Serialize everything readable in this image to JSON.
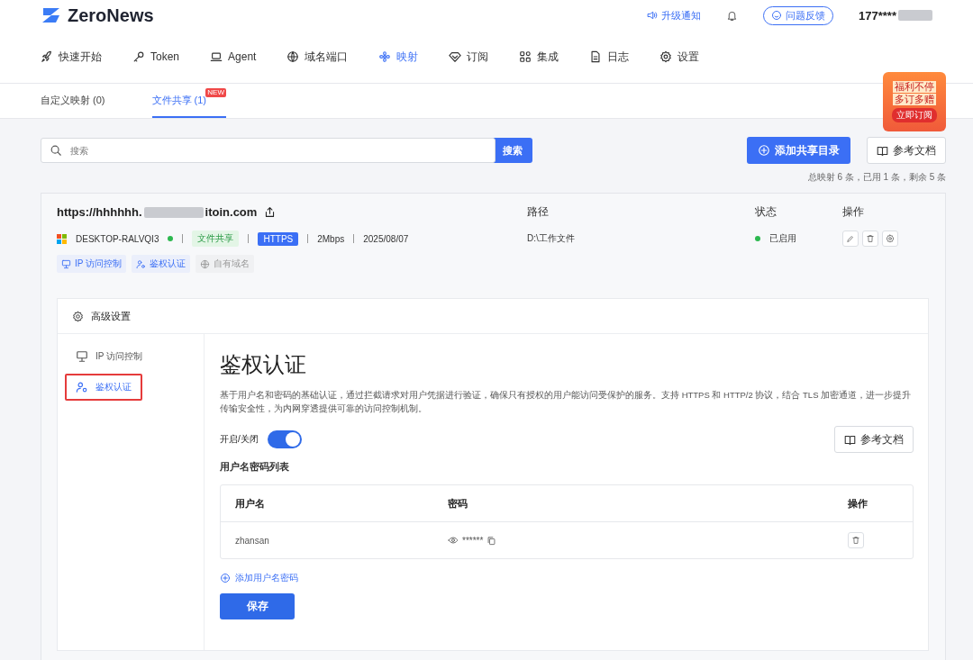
{
  "header": {
    "logo": "ZeroNews",
    "upgrade": "升级通知",
    "feedback": "问题反馈",
    "user": "177****"
  },
  "nav": [
    {
      "label": "快速开始",
      "selected": false
    },
    {
      "label": "Token",
      "selected": false
    },
    {
      "label": "Agent",
      "selected": false
    },
    {
      "label": "域名端口",
      "selected": false
    },
    {
      "label": "映射",
      "selected": true
    },
    {
      "label": "订阅",
      "selected": false
    },
    {
      "label": "集成",
      "selected": false
    },
    {
      "label": "日志",
      "selected": false
    },
    {
      "label": "设置",
      "selected": false
    }
  ],
  "subtabs": [
    {
      "label": "自定义映射 (0)",
      "selected": false
    },
    {
      "label": "文件共享 (1)",
      "selected": true,
      "badge": "NEW"
    }
  ],
  "promo": {
    "line1": "福利不停",
    "line2": "多订多赠",
    "button": "立即订阅"
  },
  "search": {
    "placeholder": "搜索",
    "button": "搜索"
  },
  "add_button": "添加共享目录",
  "docs_button": "参考文档",
  "summary": "总映射 6 条，已用 1 条，剩余 5 条",
  "mapping": {
    "url_prefix": "https://hhhhhh.",
    "url_suffix": "itoin.com",
    "col_path": "路径",
    "col_status": "状态",
    "col_actions": "操作",
    "device": "DESKTOP-RALVQI3",
    "online": true,
    "type_tag": "文件共享",
    "protocol": "HTTPS",
    "bandwidth": "2Mbps",
    "date": "2025/08/07",
    "path": "D:\\工作文件",
    "status": "已启用",
    "features": [
      {
        "label": "IP 访问控制",
        "enabled": true
      },
      {
        "label": "鉴权认证",
        "enabled": true
      },
      {
        "label": "自有域名",
        "enabled": false
      }
    ]
  },
  "advanced": {
    "title": "高级设置",
    "side_items": [
      {
        "label": "IP 访问控制",
        "selected": false,
        "highlighted": false
      },
      {
        "label": "鉴权认证",
        "selected": true,
        "highlighted": true
      }
    ],
    "heading": "鉴权认证",
    "description": "基于用户名和密码的基础认证，通过拦截请求对用户凭据进行验证，确保只有授权的用户能访问受保护的服务。支持 HTTPS 和 HTTP/2 协议，结合 TLS 加密通道，进一步提升传输安全性，为内网穿透提供可靠的访问控制机制。",
    "toggle_label": "开启/关闭",
    "toggle_on": true,
    "docs_button": "参考文档",
    "list_title": "用户名密码列表",
    "columns": [
      "用户名",
      "密码",
      "操作"
    ],
    "rows": [
      {
        "username": "zhansan",
        "password": "******"
      }
    ],
    "add_link": "添加用户名密码",
    "save": "保存"
  }
}
